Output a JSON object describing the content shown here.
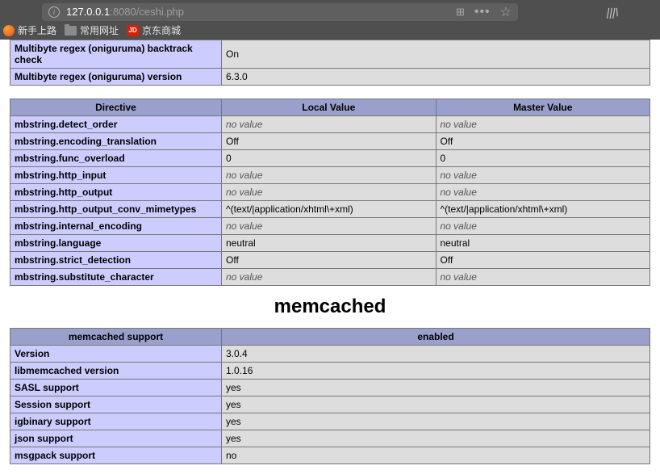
{
  "browser": {
    "url_host": "127.0.0.1",
    "url_rest": ":8080/ceshi.php",
    "bookmarks": [
      "新手上路",
      "常用网址",
      "京东商城"
    ]
  },
  "topTable": {
    "rows": [
      {
        "label": "Multibyte regex (oniguruma) backtrack check",
        "value": "On"
      },
      {
        "label": "Multibyte regex (oniguruma) version",
        "value": "6.3.0"
      }
    ]
  },
  "directiveTable": {
    "headers": [
      "Directive",
      "Local Value",
      "Master Value"
    ],
    "rows": [
      {
        "d": "mbstring.detect_order",
        "lv": "no value",
        "mv": "no value",
        "lvn": true,
        "mvn": true
      },
      {
        "d": "mbstring.encoding_translation",
        "lv": "Off",
        "mv": "Off"
      },
      {
        "d": "mbstring.func_overload",
        "lv": "0",
        "mv": "0"
      },
      {
        "d": "mbstring.http_input",
        "lv": "no value",
        "mv": "no value",
        "lvn": true,
        "mvn": true
      },
      {
        "d": "mbstring.http_output",
        "lv": "no value",
        "mv": "no value",
        "lvn": true,
        "mvn": true
      },
      {
        "d": "mbstring.http_output_conv_mimetypes",
        "lv": "^(text/|application/xhtml\\+xml)",
        "mv": "^(text/|application/xhtml\\+xml)"
      },
      {
        "d": "mbstring.internal_encoding",
        "lv": "no value",
        "mv": "no value",
        "lvn": true,
        "mvn": true
      },
      {
        "d": "mbstring.language",
        "lv": "neutral",
        "mv": "neutral"
      },
      {
        "d": "mbstring.strict_detection",
        "lv": "Off",
        "mv": "Off"
      },
      {
        "d": "mbstring.substitute_character",
        "lv": "no value",
        "mv": "no value",
        "lvn": true,
        "mvn": true
      }
    ]
  },
  "memcached": {
    "title": "memcached",
    "header": {
      "left": "memcached support",
      "right": "enabled"
    },
    "rows": [
      {
        "label": "Version",
        "value": "3.0.4"
      },
      {
        "label": "libmemcached version",
        "value": "1.0.16"
      },
      {
        "label": "SASL support",
        "value": "yes"
      },
      {
        "label": "Session support",
        "value": "yes"
      },
      {
        "label": "igbinary support",
        "value": "yes"
      },
      {
        "label": "json support",
        "value": "yes"
      },
      {
        "label": "msgpack support",
        "value": "no"
      }
    ]
  }
}
